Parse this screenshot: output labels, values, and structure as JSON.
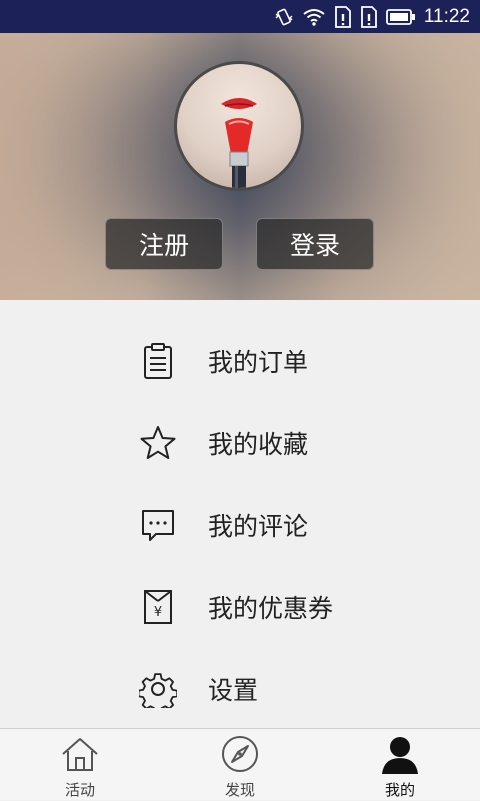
{
  "status_bar": {
    "time": "11:22",
    "icons": [
      "vibrate-icon",
      "wifi-icon",
      "sim1-alert-icon",
      "sim2-alert-icon",
      "battery-icon"
    ]
  },
  "hero": {
    "avatar_icon": "avatar-image",
    "register_label": "注册",
    "login_label": "登录"
  },
  "menu": {
    "items": [
      {
        "label": "我的订单",
        "icon": "clipboard-icon"
      },
      {
        "label": "我的收藏",
        "icon": "star-icon"
      },
      {
        "label": "我的评论",
        "icon": "comment-icon"
      },
      {
        "label": "我的优惠券",
        "icon": "coupon-icon"
      },
      {
        "label": "设置",
        "icon": "gear-icon"
      }
    ]
  },
  "tabbar": {
    "tabs": [
      {
        "label": "活动",
        "icon": "home-icon"
      },
      {
        "label": "发现",
        "icon": "compass-icon"
      },
      {
        "label": "我的",
        "icon": "user-icon",
        "active": true
      }
    ]
  },
  "colors": {
    "status_bar_bg": "#1c2257",
    "menu_bg": "#f0f0f0",
    "tabbar_bg": "#f5f5f5",
    "text": "#222222"
  }
}
